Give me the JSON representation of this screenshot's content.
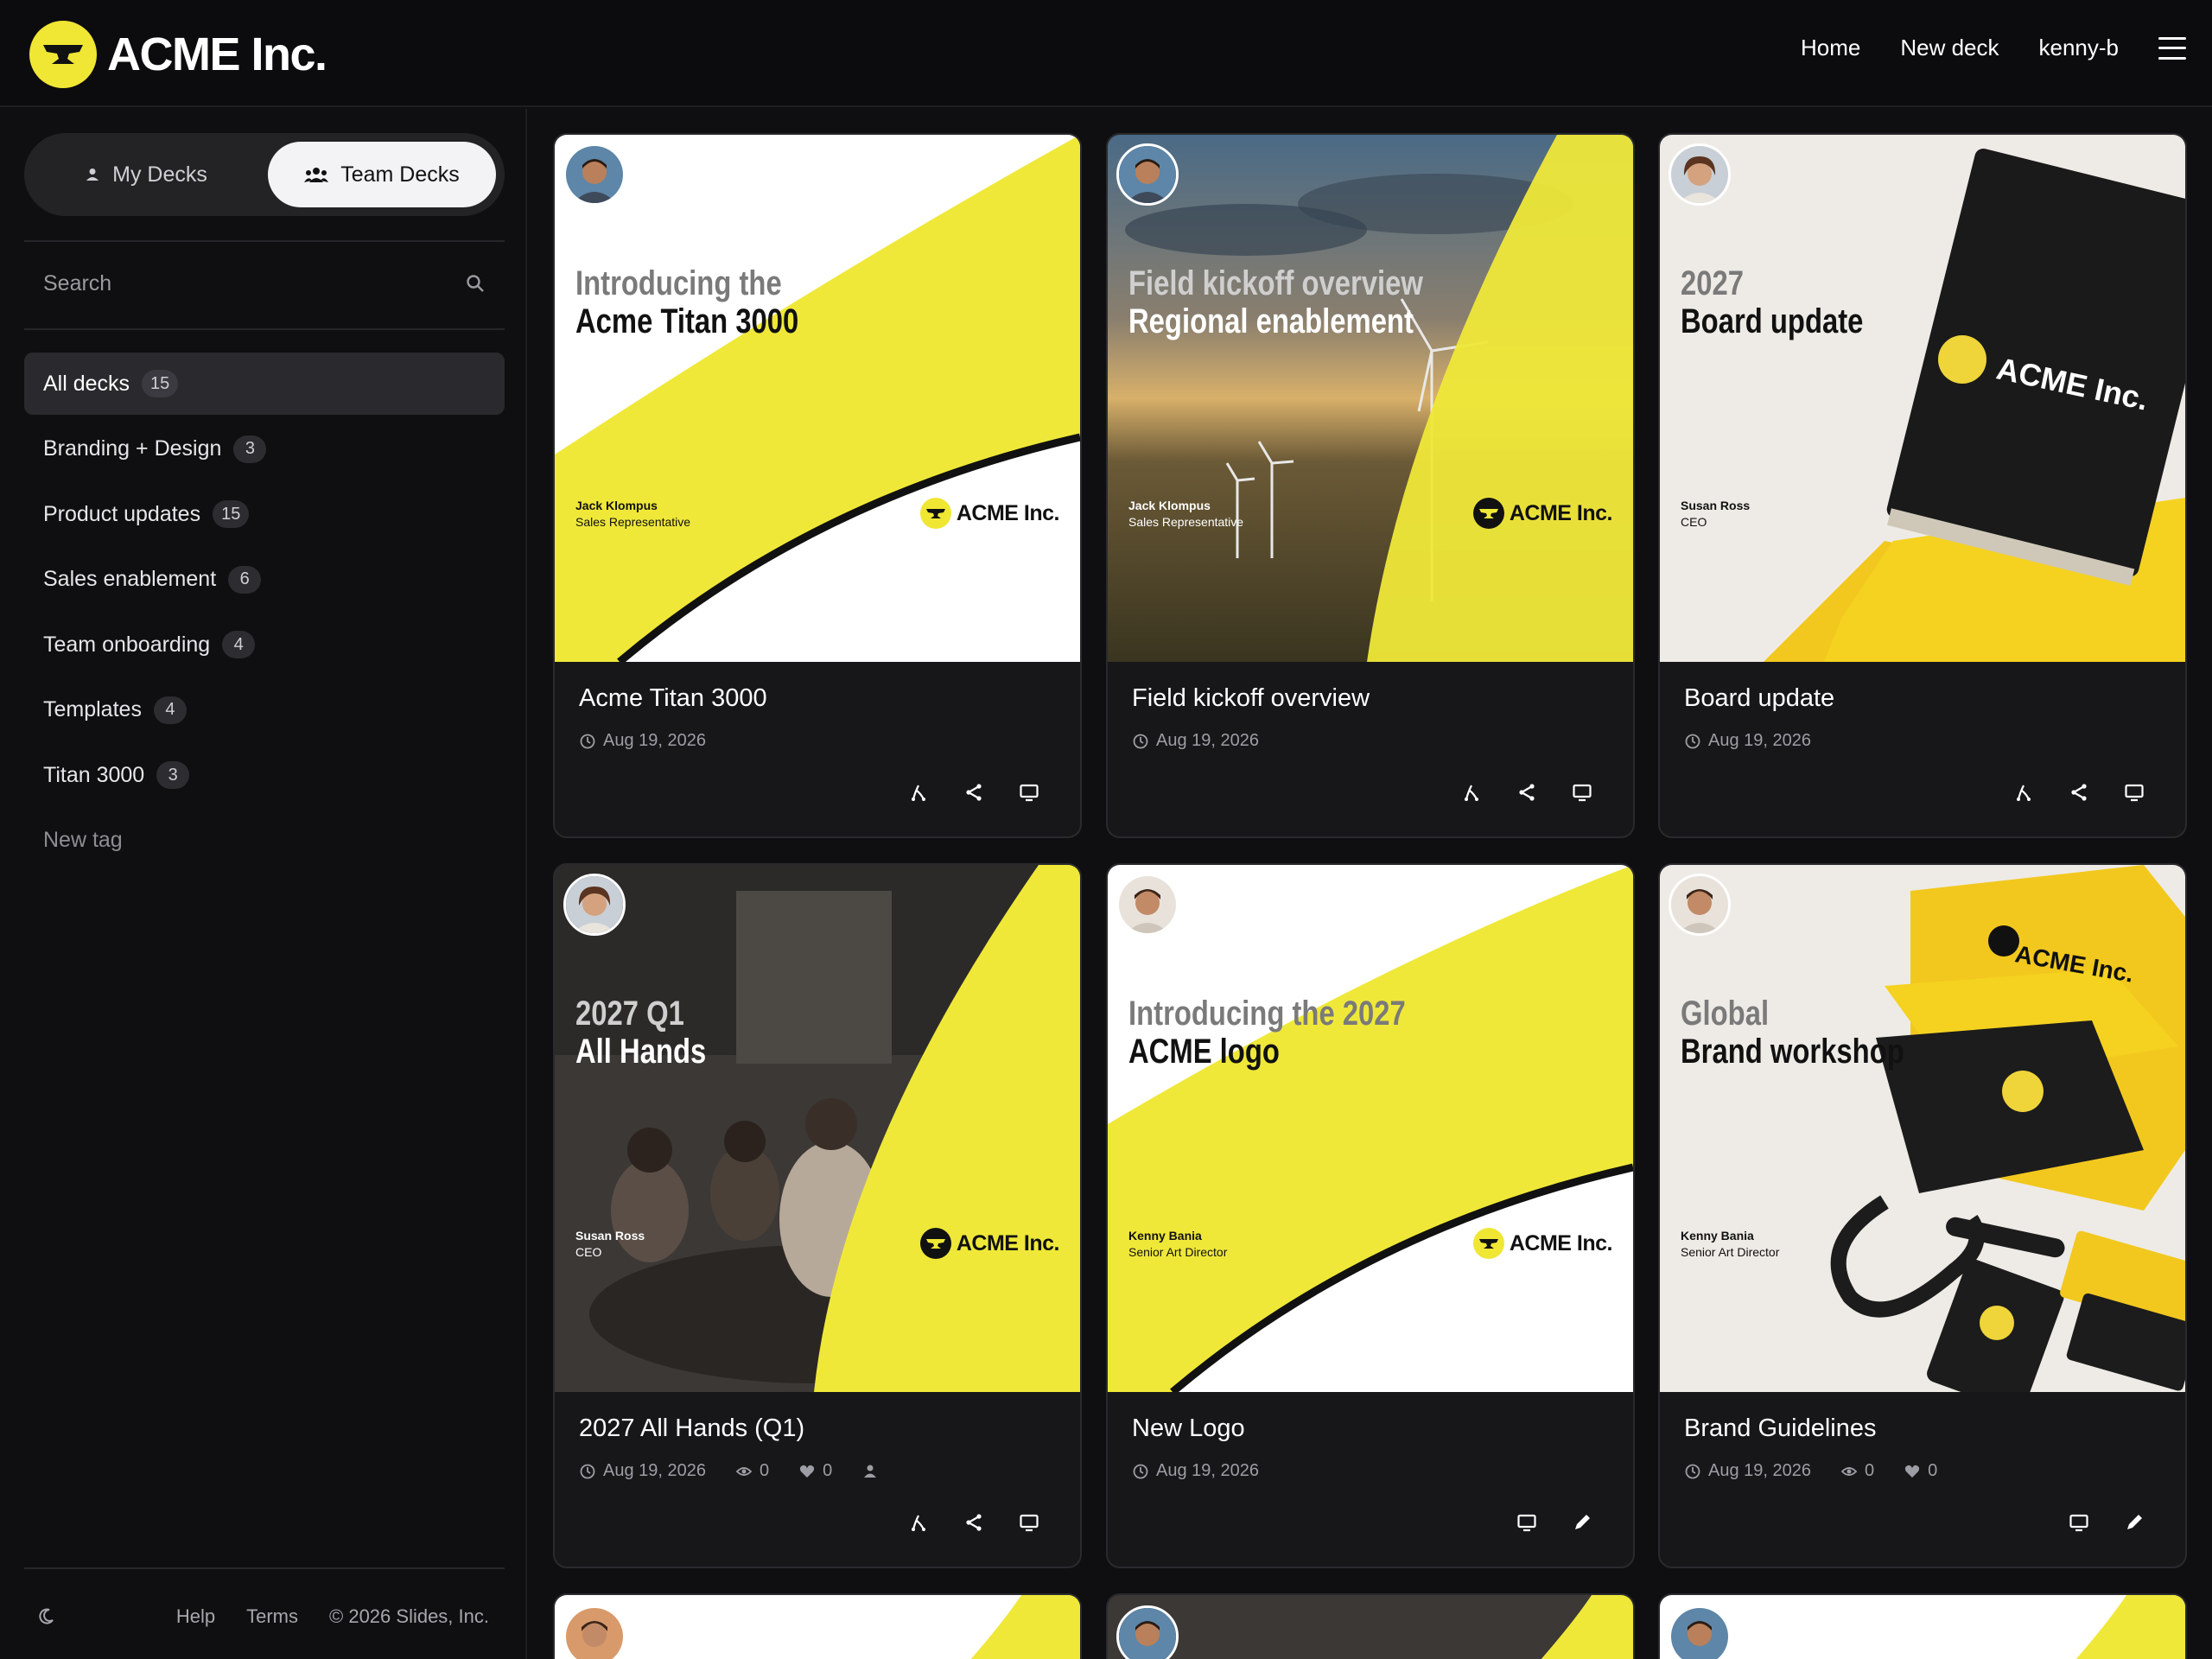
{
  "header": {
    "brand": "ACME Inc.",
    "nav": [
      "Home",
      "New deck",
      "kenny-b"
    ],
    "menu_icon": "hamburger-icon"
  },
  "sidebar": {
    "toggle": {
      "my": "My Decks",
      "team": "Team Decks",
      "selected": "team"
    },
    "search_placeholder": "Search",
    "tags": [
      {
        "label": "All decks",
        "count": "15",
        "active": true
      },
      {
        "label": "Branding + Design",
        "count": "3"
      },
      {
        "label": "Product updates",
        "count": "15"
      },
      {
        "label": "Sales enablement",
        "count": "6"
      },
      {
        "label": "Team onboarding",
        "count": "4"
      },
      {
        "label": "Templates",
        "count": "4"
      },
      {
        "label": "Titan 3000",
        "count": "3"
      }
    ],
    "new_tag": "New tag",
    "footer": {
      "help": "Help",
      "terms": "Terms",
      "copyright": "© 2026 Slides, Inc."
    }
  },
  "decks": [
    {
      "title": "Acme Titan 3000",
      "date": "Aug 19, 2026",
      "slide": {
        "line1": "Introducing the",
        "line2": "Acme Titan 3000",
        "presenter": "Jack Klompus",
        "role": "Sales Representative",
        "logo": "ACME Inc."
      }
    },
    {
      "title": "Field kickoff overview",
      "date": "Aug 19, 2026",
      "slide": {
        "line1": "Field kickoff overview",
        "line2": "Regional enablement",
        "presenter": "Jack Klompus",
        "role": "Sales Representative",
        "logo": "ACME Inc."
      }
    },
    {
      "title": "Board update",
      "date": "Aug 19, 2026",
      "slide": {
        "line1": "2027",
        "line2": "Board update",
        "presenter": "Susan Ross",
        "role": "CEO",
        "logo": "ACME Inc."
      }
    },
    {
      "title": "2027 All Hands (Q1)",
      "date": "Aug 19, 2026",
      "views": "0",
      "likes": "0",
      "slide": {
        "line1": "2027 Q1",
        "line2": "All Hands",
        "presenter": "Susan Ross",
        "role": "CEO",
        "logo": "ACME Inc."
      }
    },
    {
      "title": "New Logo",
      "date": "Aug 19, 2026",
      "slide": {
        "line1": "Introducing the 2027",
        "line2": "ACME logo",
        "presenter": "Kenny Bania",
        "role": "Senior Art Director",
        "logo": "ACME Inc."
      }
    },
    {
      "title": "Brand Guidelines",
      "date": "Aug 19, 2026",
      "views": "0",
      "likes": "0",
      "slide": {
        "line1": "Global",
        "line2": "Brand workshop",
        "presenter": "Kenny Bania",
        "role": "Senior Art Director",
        "logo": "ACME Inc."
      }
    }
  ],
  "colors": {
    "accent": "#f0e634",
    "background": "#0f0f11",
    "card": "#17171a"
  }
}
